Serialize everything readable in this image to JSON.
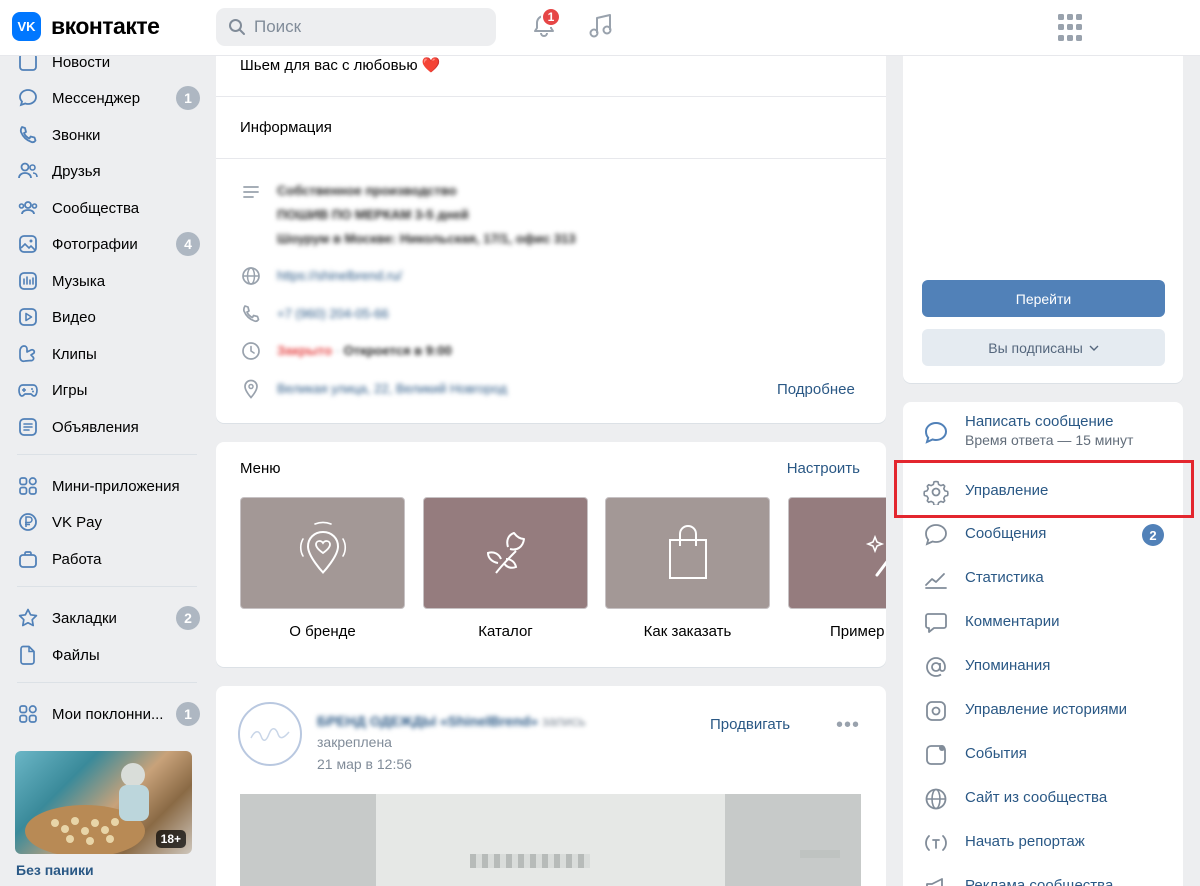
{
  "header": {
    "logo_mark": "VK",
    "logo_text": "вконтакте",
    "search_placeholder": "Поиск",
    "notifications_count": "1"
  },
  "sidebar": {
    "items": [
      {
        "label": "Новости",
        "icon": "newspaper-icon"
      },
      {
        "label": "Мессенджер",
        "icon": "message-icon",
        "count": "1"
      },
      {
        "label": "Звонки",
        "icon": "phone-icon"
      },
      {
        "label": "Друзья",
        "icon": "friends-icon"
      },
      {
        "label": "Сообщества",
        "icon": "communities-icon"
      },
      {
        "label": "Фотографии",
        "icon": "photo-icon",
        "count": "4"
      },
      {
        "label": "Музыка",
        "icon": "music-icon"
      },
      {
        "label": "Видео",
        "icon": "video-icon"
      },
      {
        "label": "Клипы",
        "icon": "clips-icon"
      },
      {
        "label": "Игры",
        "icon": "gamepad-icon"
      },
      {
        "label": "Объявления",
        "icon": "classifieds-icon"
      },
      {
        "label": "Мини-приложения",
        "icon": "apps-icon"
      },
      {
        "label": "VK Pay",
        "icon": "vkpay-icon"
      },
      {
        "label": "Работа",
        "icon": "briefcase-icon"
      },
      {
        "label": "Закладки",
        "icon": "star-icon",
        "count": "2"
      },
      {
        "label": "Файлы",
        "icon": "file-icon"
      },
      {
        "label": "Мои поклонни...",
        "icon": "apps-icon",
        "count": "1"
      }
    ],
    "promo": {
      "age_label": "18+",
      "title": "Без паники"
    }
  },
  "info_card": {
    "status_text": "Шьем для вас с любовью ❤️",
    "section_title": "Информация",
    "description_lines": [
      "Собственное производство",
      "ПОШИВ ПО МЕРКАМ 3-5 дней",
      "Шоурум в Москве: Никольская, 17/1, офис 313"
    ],
    "website": "https://shinelbrend.ru/",
    "phone": "+7 (960) 204-05-66",
    "hours_closed": "Закрыто",
    "hours_separator": " · ",
    "hours_opens": "Откроется в 9:00",
    "address": "Великая улица, 22, Великий Новгород",
    "more_link": "Подробнее"
  },
  "menu_card": {
    "title": "Меню",
    "configure_link": "Настроить",
    "tiles": [
      {
        "label": "О бренде",
        "icon": "location-heart-icon",
        "color": "#a39896"
      },
      {
        "label": "Каталог",
        "icon": "flower-icon",
        "color": "#957c7e"
      },
      {
        "label": "Как заказать",
        "icon": "shopping-bag-icon",
        "color": "#a39896"
      },
      {
        "label": "Пример",
        "icon": "magic-wand-icon",
        "color": "#957c7e"
      }
    ]
  },
  "post": {
    "author": "БРЕНД ОДЕЖДЫ «ShinelBrend»",
    "action": "запись",
    "pinned": "закреплена",
    "date": "21 мар в 12:56",
    "promote_link": "Продвигать",
    "more": "•••"
  },
  "right_panel": {
    "primary_button": "Перейти",
    "subscribed_button": "Вы подписаны",
    "actions": [
      {
        "label": "Написать сообщение",
        "sub": "Время ответа — 15 минут",
        "icon": "message-icon"
      },
      {
        "label": "Управление",
        "icon": "gear-icon"
      },
      {
        "label": "Сообщения",
        "icon": "message-icon",
        "badge": "2"
      },
      {
        "label": "Статистика",
        "icon": "chart-icon"
      },
      {
        "label": "Комментарии",
        "icon": "comment-icon"
      },
      {
        "label": "Упоминания",
        "icon": "at-icon"
      },
      {
        "label": "Управление историями",
        "icon": "stories-icon"
      },
      {
        "label": "События",
        "icon": "event-icon"
      },
      {
        "label": "Сайт из сообщества",
        "icon": "globe-icon"
      },
      {
        "label": "Начать репортаж",
        "icon": "broadcast-icon"
      },
      {
        "label": "Реклама сообщества",
        "icon": "megaphone-icon"
      }
    ]
  },
  "colors": {
    "brand": "#0077ff",
    "link": "#2a5885",
    "primary_button": "#5181b8",
    "highlight": "#e3262e",
    "background": "#edeef0"
  }
}
